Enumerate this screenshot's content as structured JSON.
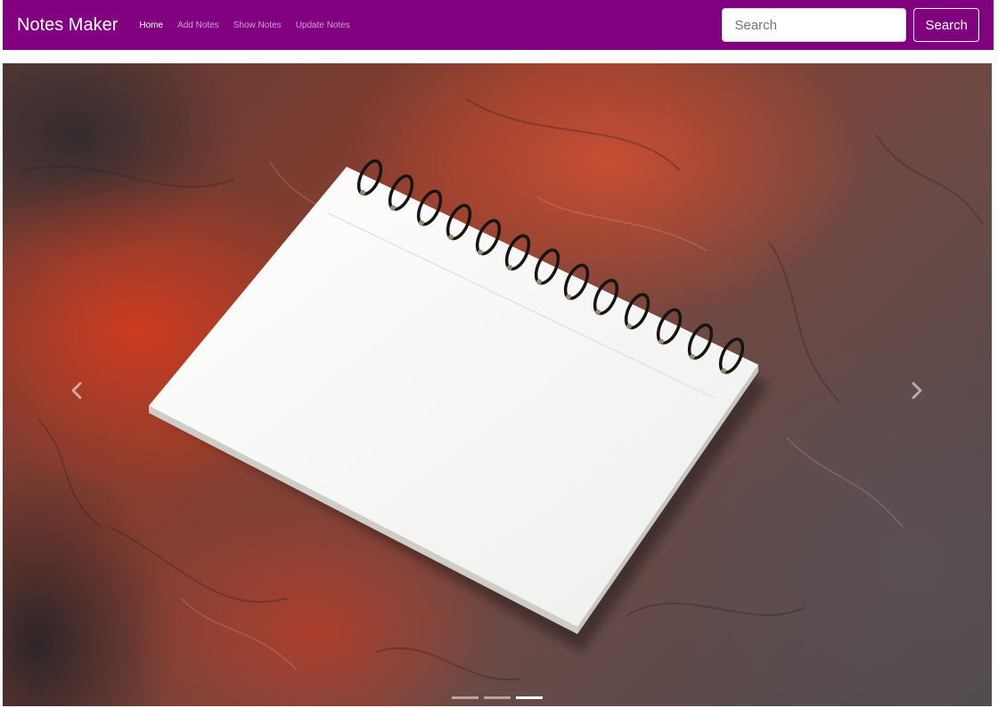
{
  "navbar": {
    "brand": "Notes Maker",
    "links": [
      {
        "label": "Home",
        "active": true
      },
      {
        "label": "Add Notes",
        "active": false
      },
      {
        "label": "Show Notes",
        "active": false
      },
      {
        "label": "Update Notes",
        "active": false
      }
    ],
    "search": {
      "placeholder": "Search",
      "button_label": "Search"
    }
  },
  "carousel": {
    "image": "spiral-notepad-on-red-textured-surface",
    "slide_count": 3,
    "active_slide": 3,
    "prev_icon": "chevron-left-icon",
    "next_icon": "chevron-right-icon"
  },
  "colors": {
    "navbar_bg": "#800080",
    "text_light": "#ffffff"
  }
}
